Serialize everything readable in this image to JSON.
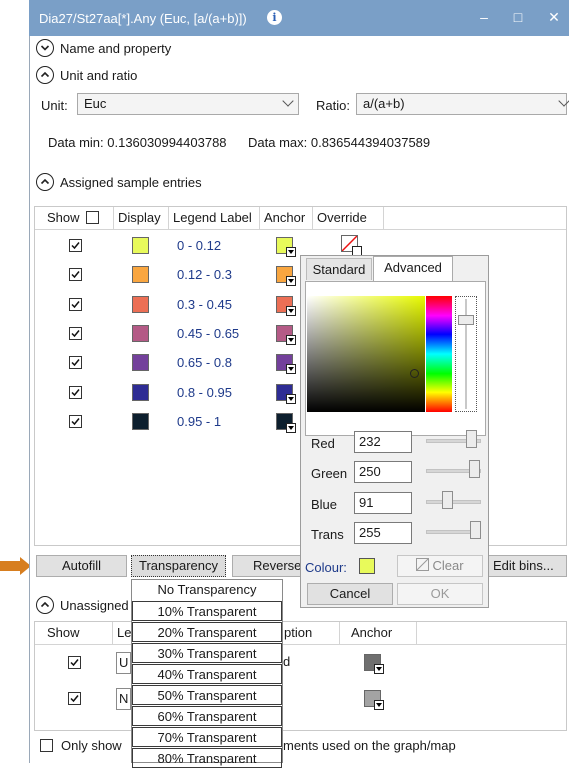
{
  "window": {
    "title": "Dia27/St27aa[*].Any (Euc, [a/(a+b)])",
    "info_glyph": "i",
    "minimize_glyph": "–",
    "maximize_glyph": "□",
    "close_glyph": "✕"
  },
  "sections": {
    "name_property": "Name and property",
    "unit_ratio": "Unit and ratio",
    "assigned": "Assigned sample entries",
    "unassigned": "Unassigned"
  },
  "unit": {
    "label": "Unit:",
    "value": "Euc"
  },
  "ratio": {
    "label": "Ratio:",
    "value": "a/(a+b)"
  },
  "data_range": {
    "min_text": "Data min: 0.136030994403788",
    "max_text": "Data max: 0.836544394037589"
  },
  "grid": {
    "headers": {
      "show": "Show",
      "display": "Display",
      "legend_label": "Legend Label",
      "anchor": "Anchor",
      "override": "Override"
    },
    "rows": [
      {
        "label": "0 - 0.12",
        "color": "#e8fa5b",
        "checked": true
      },
      {
        "label": "0.12 - 0.3",
        "color": "#f9a640",
        "checked": true
      },
      {
        "label": "0.3 - 0.45",
        "color": "#ec6f55",
        "checked": true
      },
      {
        "label": "0.45 - 0.65",
        "color": "#b45a86",
        "checked": true
      },
      {
        "label": "0.65 - 0.8",
        "color": "#73409b",
        "checked": true
      },
      {
        "label": "0.8 - 0.95",
        "color": "#2e2c94",
        "checked": true
      },
      {
        "label": "0.95 - 1",
        "color": "#0d1f2e",
        "checked": true
      }
    ]
  },
  "buttons": {
    "autofill": "Autofill",
    "transparency": "Transparency",
    "reverse": "Reverse",
    "edit_bins": "Edit bins..."
  },
  "color_picker": {
    "tabs": {
      "standard": "Standard",
      "advanced": "Advanced"
    },
    "red": {
      "label": "Red",
      "value": "232",
      "level": 232
    },
    "green": {
      "label": "Green",
      "value": "250",
      "level": 250
    },
    "blue": {
      "label": "Blue",
      "value": "91",
      "level": 91
    },
    "trans": {
      "label": "Trans",
      "value": "255",
      "level": 255
    },
    "colour_label": "Colour:",
    "colour": "#e8fa5b",
    "clear": "Clear",
    "cancel": "Cancel",
    "ok": "OK"
  },
  "transparency_menu": [
    "No Transparency",
    "10% Transparent",
    "20% Transparent",
    "30% Transparent",
    "40% Transparent",
    "50% Transparent",
    "60% Transparent",
    "70% Transparent",
    "80% Transparent"
  ],
  "unassigned_grid": {
    "headers": {
      "show": "Show",
      "legend_prefix": "Le",
      "description_suffix": "ption",
      "anchor": "Anchor"
    },
    "rows": [
      {
        "prefix": "U",
        "suffix": "d",
        "color": "#6f6f6f",
        "checked": true
      },
      {
        "prefix": "N",
        "suffix": "",
        "color": "#a3a3a3",
        "checked": true
      }
    ]
  },
  "footer": {
    "only_show_prefix": "Only show",
    "only_show_suffix": "ments used on the graph/map"
  },
  "colors": {
    "pointer_arrow": "#d77e1f",
    "titlebar": "#7a9fc7",
    "label_blue": "#1e3a8a"
  }
}
